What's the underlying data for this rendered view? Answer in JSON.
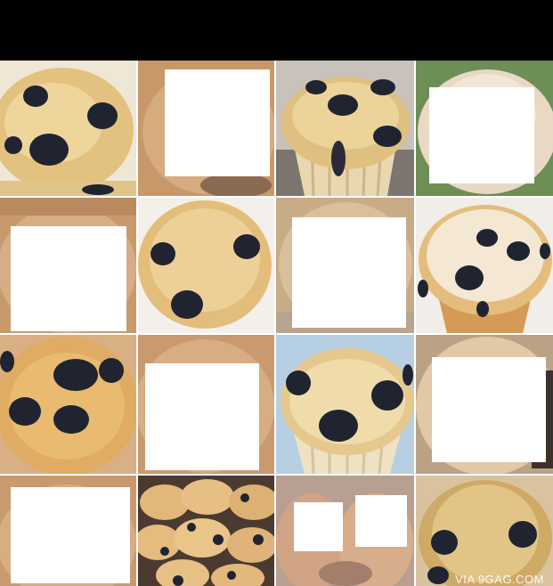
{
  "watermark": "VIA 9GAG.COM",
  "colors": {
    "background": "#ffffff",
    "top_bar": "#000000",
    "muffin_crust": "#d9a85a",
    "muffin_light": "#ead3a0",
    "blueberry": "#1f2430",
    "wrapper": "#e7d3ac",
    "chihuahua_fur": "#d2a87c"
  },
  "grid": {
    "rows": [
      [
        "muffin",
        "chihuahua",
        "muffin",
        "chihuahua"
      ],
      [
        "chihuahua",
        "muffin",
        "chihuahua",
        "muffin"
      ],
      [
        "muffin",
        "chihuahua",
        "muffin",
        "chihuahua"
      ],
      [
        "chihuahua",
        "muffin",
        "chihuahua",
        "muffin"
      ]
    ]
  }
}
